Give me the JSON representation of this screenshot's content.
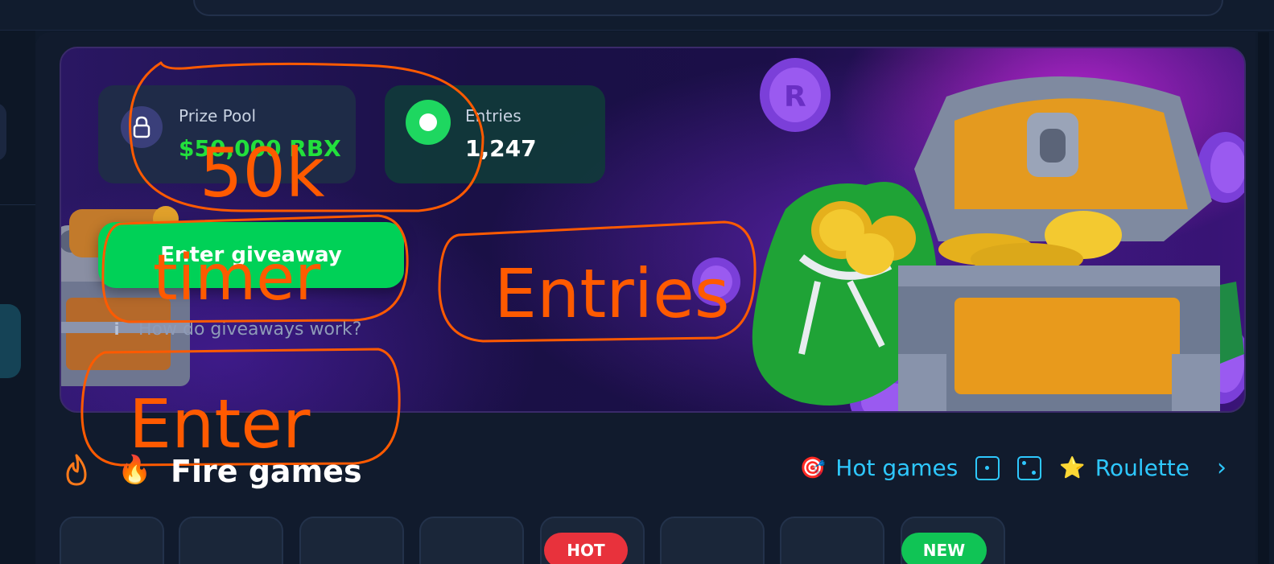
{
  "banner": {
    "prize_pool": {
      "label": "Prize Pool",
      "value": "$50,000 RBX"
    },
    "entries": {
      "label": "Entries",
      "value": "1,247"
    },
    "enter_button": "Enter giveaway",
    "help_link": "How do giveaways work?",
    "info_icon": "i"
  },
  "annotations": {
    "note1": "50k",
    "note2": "timer",
    "note3": "Entries",
    "note4": "Enter",
    "color": "#ff5a00"
  },
  "section": {
    "title": "Fire games",
    "title_icon": "🔥",
    "tabs": [
      {
        "label": "Hot games",
        "icon": "🎯"
      },
      {
        "label": "Roulette",
        "icon": "⭐"
      }
    ],
    "next_icon": "›"
  },
  "game_cards": {
    "badges": {
      "hot": "HOT",
      "new": "NEW"
    }
  },
  "colors": {
    "accent_green": "#00d157",
    "prize_green": "#22e03c",
    "link_cyan": "#2ec8ff",
    "background": "#0f1a2b"
  }
}
